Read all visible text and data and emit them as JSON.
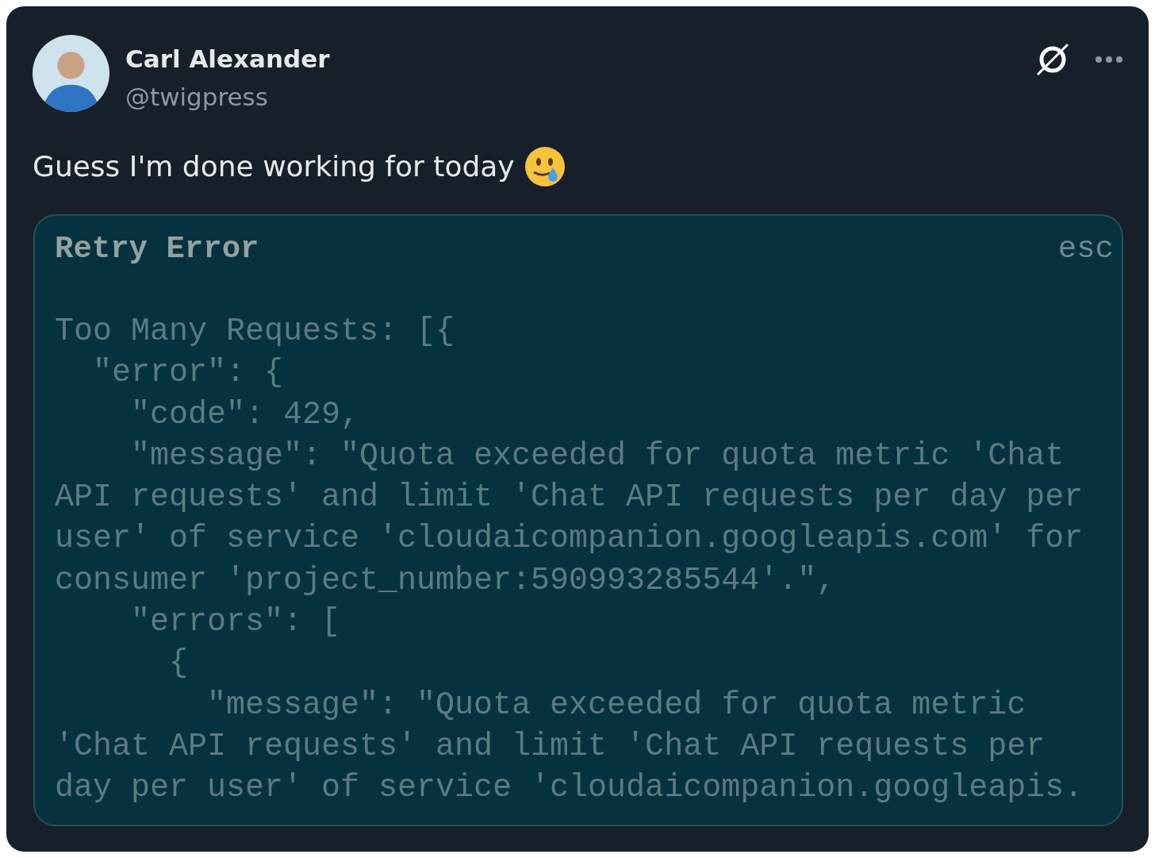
{
  "author": {
    "name": "Carl Alexander",
    "handle": "@twigpress"
  },
  "post": {
    "text": "Guess I'm done working for today"
  },
  "error_panel": {
    "title": "Retry Error",
    "dismiss": "esc",
    "lines": [
      "Too Many Requests: [{",
      "  \"error\": {",
      "    \"code\": 429,",
      "    \"message\": \"Quota exceeded for quota metric 'Chat",
      "API requests' and limit 'Chat API requests per day per",
      "user' of service 'cloudaicompanion.googleapis.com' for",
      "consumer 'project_number:590993285544'.\",",
      "    \"errors\": [",
      "      {",
      "        \"message\": \"Quota exceeded for quota metric",
      "'Chat API requests' and limit 'Chat API requests per",
      "day per user' of service 'cloudaicompanion.googleapis."
    ]
  }
}
